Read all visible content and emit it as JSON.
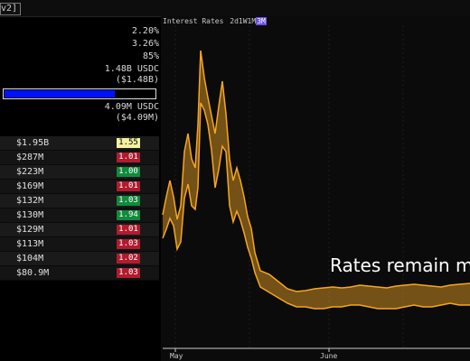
{
  "header": {
    "tag": "v2]"
  },
  "stats": {
    "line1": "2.20%",
    "line2": "3.26%",
    "line3": "85%",
    "supply": "1.48B USDC",
    "supply_usd": "($1.48B)",
    "utilization": 0.85,
    "borrow": "4.09M USDC",
    "borrow_usd": "($4.09M)"
  },
  "table": {
    "rows": [
      {
        "amount": "$1.95B",
        "badge": "1.55",
        "color": "#f2f2a0",
        "text": "#000000"
      },
      {
        "amount": "$287M",
        "badge": "1.01",
        "color": "#b01c2e",
        "text": "#ffffff"
      },
      {
        "amount": "$223M",
        "badge": "1.00",
        "color": "#128a3c",
        "text": "#ffffff"
      },
      {
        "amount": "$169M",
        "badge": "1.01",
        "color": "#b01c2e",
        "text": "#ffffff"
      },
      {
        "amount": "$132M",
        "badge": "1.03",
        "color": "#128a3c",
        "text": "#ffffff"
      },
      {
        "amount": "$130M",
        "badge": "1.94",
        "color": "#128a3c",
        "text": "#ffffff"
      },
      {
        "amount": "$129M",
        "badge": "1.01",
        "color": "#b01c2e",
        "text": "#ffffff"
      },
      {
        "amount": "$113M",
        "badge": "1.03",
        "color": "#b01c2e",
        "text": "#ffffff"
      },
      {
        "amount": "$104M",
        "badge": "1.02",
        "color": "#b01c2e",
        "text": "#ffffff"
      },
      {
        "amount": "$80.9M",
        "badge": "1.03",
        "color": "#b01c2e",
        "text": "#ffffff"
      }
    ]
  },
  "chart": {
    "title": "Interest Rates",
    "ranges": [
      "2d",
      "1W",
      "1M",
      "3M"
    ],
    "selected_range": "3M",
    "overlay_text": "Rates remain m",
    "x_labels": [
      "May",
      "June"
    ],
    "band_color": "#f5a623"
  }
}
